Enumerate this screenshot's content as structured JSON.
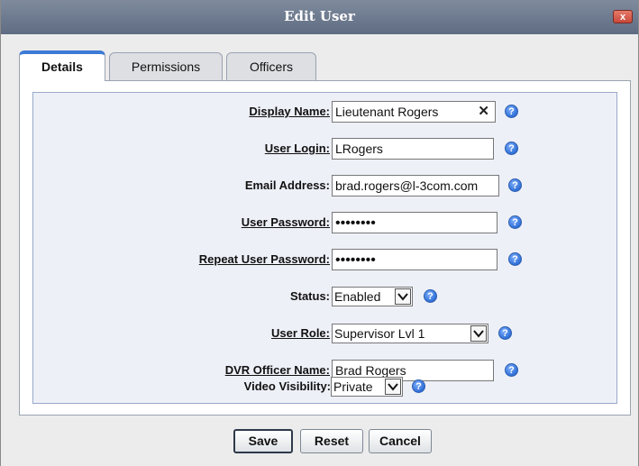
{
  "dialog": {
    "title": "Edit User",
    "close_symbol": "x"
  },
  "tabs": [
    {
      "label": "Details",
      "active": true
    },
    {
      "label": "Permissions",
      "active": false
    },
    {
      "label": "Officers",
      "active": false
    }
  ],
  "form": {
    "display_name": {
      "label": "Display Name:",
      "value": "Lieutenant Rogers",
      "clear_symbol": "✕"
    },
    "user_login": {
      "label": "User Login:",
      "value": "LRogers"
    },
    "email_address": {
      "label": "Email Address:",
      "value": "brad.rogers@l-3com.com"
    },
    "user_password": {
      "label": "User Password:",
      "value": "••••••••"
    },
    "repeat_password": {
      "label": "Repeat User Password:",
      "value": "••••••••"
    },
    "status": {
      "label": "Status:",
      "value": "Enabled"
    },
    "user_role": {
      "label": "User Role:",
      "value": "Supervisor Lvl 1"
    },
    "dvr_officer_name": {
      "label": "DVR Officer Name:",
      "value": "Brad Rogers"
    },
    "video_visibility": {
      "label": "Video Visibility:",
      "value": "Private"
    }
  },
  "help_symbol": "?",
  "buttons": {
    "save": "Save",
    "reset": "Reset",
    "cancel": "Cancel"
  },
  "icons": {
    "help": "help-icon",
    "dropdown": "chevron-down-icon",
    "close": "close-icon",
    "clear": "clear-icon"
  },
  "colors": {
    "titlebar": "#6b778b",
    "active_tab_accent": "#3d7ad6",
    "help_icon": "#2f6fd6",
    "close_button": "#d25a4a"
  }
}
